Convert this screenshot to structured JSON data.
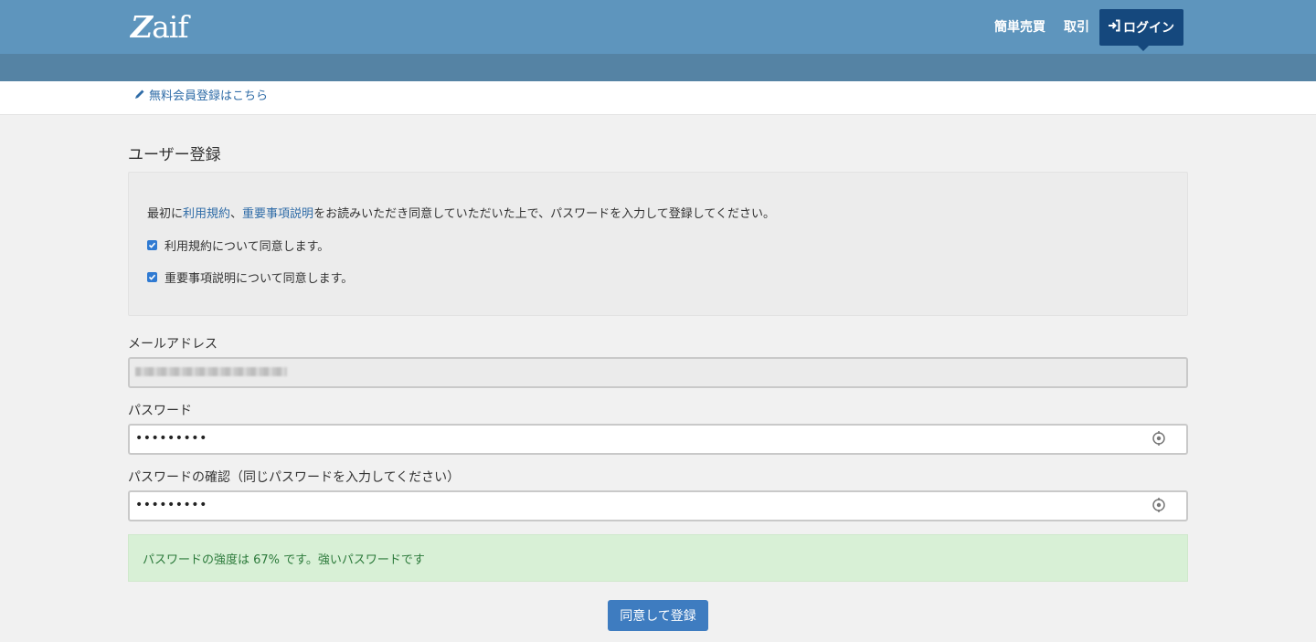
{
  "header": {
    "logo": "Zaif",
    "nav": {
      "simple_trade": "簡単売買",
      "trade": "取引",
      "login": "ログイン"
    }
  },
  "infobar": {
    "register_link": "無料会員登録はこちら"
  },
  "page": {
    "title": "ユーザー登録"
  },
  "consent": {
    "intro_prefix": "最初に",
    "terms_link": "利用規約",
    "separator": "、",
    "explanation_link": "重要事項説明",
    "intro_suffix": "をお読みいただき同意していただいた上で、パスワードを入力して登録してください。",
    "agree_terms": "利用規約について同意します。",
    "agree_explanation": "重要事項説明について同意します。",
    "agree_terms_checked": true,
    "agree_explanation_checked": true
  },
  "form": {
    "email_label": "メールアドレス",
    "password_label": "パスワード",
    "password_value": "•••••••••",
    "confirm_label": "パスワードの確認（同じパスワードを入力してください）",
    "confirm_value": "•••••••••"
  },
  "strength": {
    "message": "パスワードの強度は 67% です。強いパスワードです",
    "percent": 67
  },
  "submit": {
    "label": "同意して登録"
  },
  "colors": {
    "header": "#5e95bd",
    "subheader": "#5583a4",
    "login_button": "#15487d",
    "link": "#2f6ca7",
    "success_bg": "#d8f0d6",
    "primary_button": "#3e7cc0"
  },
  "icons": [
    "login-icon",
    "pencil-icon",
    "checkbox-check-icon",
    "eye-icon"
  ]
}
